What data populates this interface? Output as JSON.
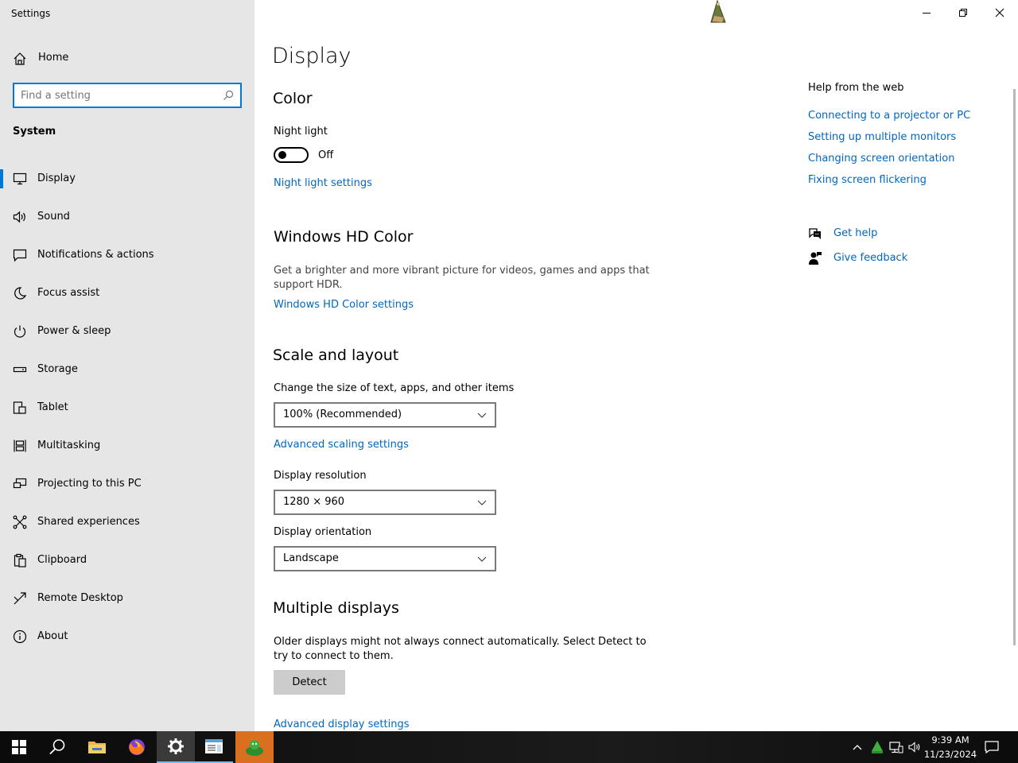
{
  "window": {
    "app_title": "Settings",
    "controls": [
      "minimize",
      "restore",
      "close"
    ]
  },
  "sidebar": {
    "home_label": "Home",
    "search_placeholder": "Find a setting",
    "section_label": "System",
    "items": [
      {
        "label": "Display",
        "icon": "monitor-icon",
        "active": true
      },
      {
        "label": "Sound",
        "icon": "speaker-icon"
      },
      {
        "label": "Notifications & actions",
        "icon": "notification-icon"
      },
      {
        "label": "Focus assist",
        "icon": "moon-icon"
      },
      {
        "label": "Power & sleep",
        "icon": "power-icon"
      },
      {
        "label": "Storage",
        "icon": "storage-icon"
      },
      {
        "label": "Tablet",
        "icon": "tablet-icon"
      },
      {
        "label": "Multitasking",
        "icon": "multitasking-icon"
      },
      {
        "label": "Projecting to this PC",
        "icon": "projector-icon"
      },
      {
        "label": "Shared experiences",
        "icon": "share-icon"
      },
      {
        "label": "Clipboard",
        "icon": "clipboard-icon"
      },
      {
        "label": "Remote Desktop",
        "icon": "remote-desktop-icon"
      },
      {
        "label": "About",
        "icon": "info-icon"
      }
    ]
  },
  "main": {
    "page_title": "Display",
    "color": {
      "heading": "Color",
      "night_light_label": "Night light",
      "night_light_state": "Off",
      "night_light_link": "Night light settings"
    },
    "hd_color": {
      "heading": "Windows HD Color",
      "description_line1": "Get a brighter and more vibrant picture for videos, games and apps that",
      "description_line2": "support HDR.",
      "link": "Windows HD Color settings"
    },
    "scale_layout": {
      "heading": "Scale and layout",
      "scale_label": "Change the size of text, apps, and other items",
      "scale_value": "100% (Recommended)",
      "advanced_link": "Advanced scaling settings",
      "resolution_label": "Display resolution",
      "resolution_value": "1280 × 960",
      "orientation_label": "Display orientation",
      "orientation_value": "Landscape"
    },
    "multiple_displays": {
      "heading": "Multiple displays",
      "description_line1": "Older displays might not always connect automatically. Select Detect to",
      "description_line2": "try to connect to them.",
      "detect_button": "Detect",
      "advanced_link": "Advanced display settings"
    }
  },
  "help": {
    "title": "Help from the web",
    "links": [
      "Connecting to a projector or PC",
      "Setting up multiple monitors",
      "Changing screen orientation",
      "Fixing screen flickering"
    ],
    "get_help": "Get help",
    "give_feedback": "Give feedback"
  },
  "taskbar": {
    "apps": [
      "start-icon",
      "search-icon",
      "file-explorer-icon",
      "firefox-icon",
      "settings-icon",
      "notepad-icon",
      "app-icon"
    ],
    "time": "9:39 AM",
    "date": "11/23/2024"
  },
  "colors": {
    "accent": "#0078d7",
    "link": "#0067c0",
    "sidebar_bg": "#e6e6e6"
  }
}
